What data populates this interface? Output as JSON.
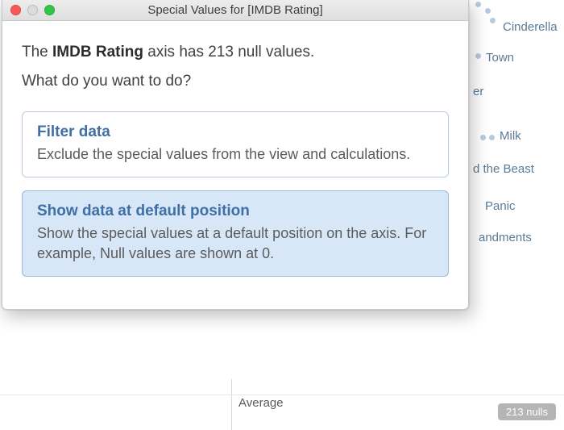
{
  "dialog": {
    "title": "Special Values for [IMDB Rating]",
    "axis_name": "IMDB Rating",
    "message_prefix": "The ",
    "message_suffix": " axis has 213 null values.",
    "question": "What do you want to do?",
    "options": [
      {
        "title": "Filter data",
        "desc": "Exclude the special values from the view and calculations.",
        "selected": false
      },
      {
        "title": "Show data at default position",
        "desc": "Show the special values at a default position on the axis. For example, Null values are shown at 0.",
        "selected": true
      }
    ]
  },
  "background": {
    "axis_label": "Average",
    "null_indicator": "213 nulls",
    "labels": [
      "Cinderella",
      "Town",
      "er",
      "Milk",
      "d the Beast",
      "Panic",
      "andments"
    ]
  }
}
